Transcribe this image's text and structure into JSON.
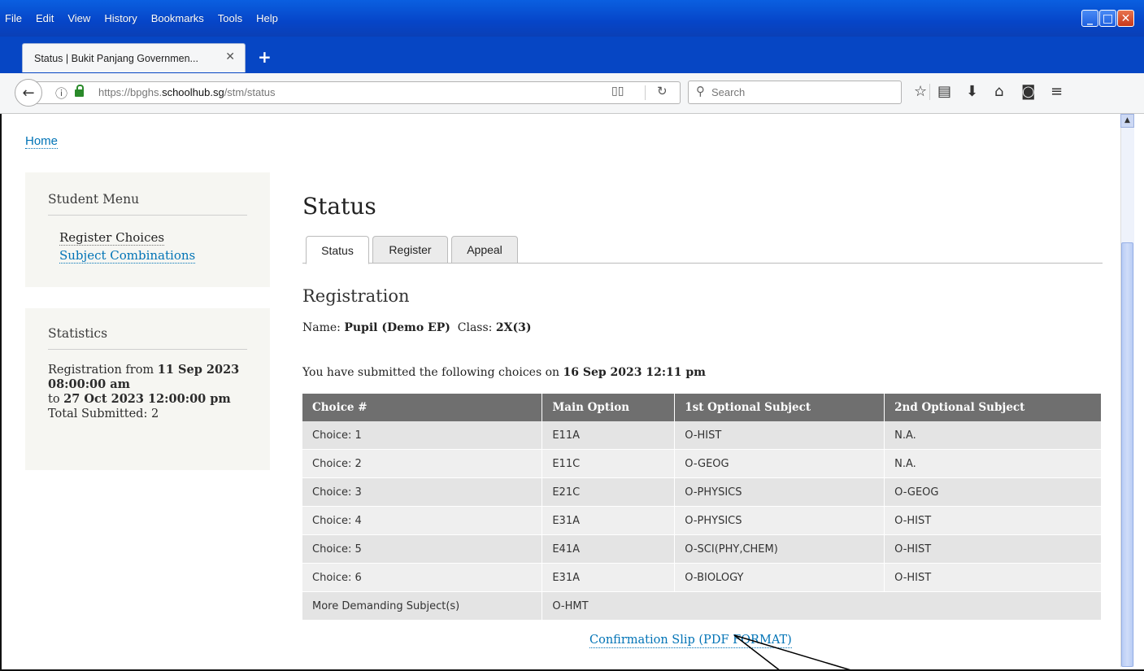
{
  "browser": {
    "menu": [
      "File",
      "Edit",
      "View",
      "History",
      "Bookmarks",
      "Tools",
      "Help"
    ],
    "tab_title": "Status | Bukit Panjang Governmen...",
    "tab_close": "✕",
    "new_tab": "+",
    "url_domain_prefix": "https://bpghs.",
    "url_domain": "schoolhub.sg",
    "url_path": "/stm/status",
    "search_placeholder": "Search",
    "icons": [
      "back-icon",
      "info-icon",
      "lock-icon",
      "reader-view-icon",
      "reload-icon",
      "search-icon",
      "bookmark-star-icon",
      "library-icon",
      "download-icon",
      "home-icon",
      "pocket-icon",
      "hamburger-menu-icon"
    ]
  },
  "page": {
    "home_link": "Home",
    "sidebar": {
      "menu_title": "Student Menu",
      "menu_items": [
        "Register Choices",
        "Subject Combinations"
      ],
      "stats_title": "Statistics",
      "stats": {
        "reg_from_label": "Registration from",
        "reg_from": "11 Sep 2023 08:00:00 am",
        "to_label": "to",
        "reg_to": "27 Oct 2023 12:00:00 pm",
        "total_label": "Total Submitted:",
        "total": "2"
      }
    },
    "title": "Status",
    "tabs": [
      "Status",
      "Register",
      "Appeal"
    ],
    "active_tab": "Status",
    "section_title": "Registration",
    "name_label": "Name:",
    "name_value": "Pupil (Demo EP)",
    "class_label": "Class:",
    "class_value": "2X(3)",
    "submitted_text": "You have submitted the following choices on",
    "submitted_date": "16 Sep 2023 12:11 pm",
    "table": {
      "headers": [
        "Choice #",
        "Main Option",
        "1st Optional Subject",
        "2nd Optional Subject"
      ],
      "rows": [
        [
          "Choice: 1",
          "E11A",
          "O-HIST",
          "N.A."
        ],
        [
          "Choice: 2",
          "E11C",
          "O-GEOG",
          "N.A."
        ],
        [
          "Choice: 3",
          "E21C",
          "O-PHYSICS",
          "O-GEOG"
        ],
        [
          "Choice: 4",
          "E31A",
          "O-PHYSICS",
          "O-HIST"
        ],
        [
          "Choice: 5",
          "E41A",
          "O-SCI(PHY,CHEM)",
          "O-HIST"
        ],
        [
          "Choice: 6",
          "E31A",
          "O-BIOLOGY",
          "O-HIST"
        ]
      ],
      "demanding_label": "More Demanding Subject(s)",
      "demanding_value": "O-HMT"
    },
    "confirmation_link": "Confirmation Slip (PDF FORMAT)"
  }
}
